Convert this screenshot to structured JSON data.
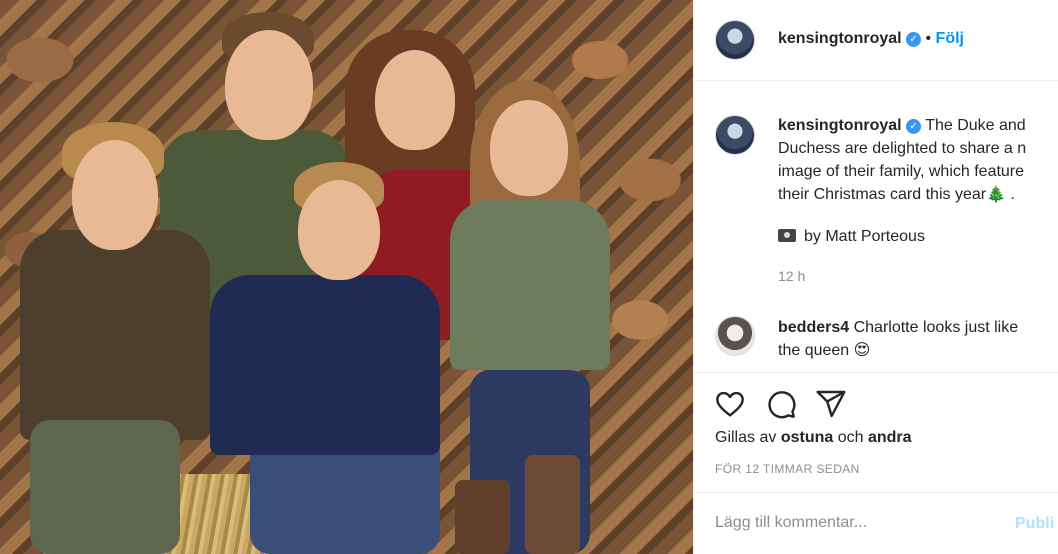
{
  "post": {
    "username": "kensingtonroyal",
    "follow_label": "Följ",
    "dot": "•"
  },
  "caption": {
    "username": "kensingtonroyal",
    "line1": "The Duke and",
    "line2": "Duchess are delighted to share a n",
    "line3": "image of their family, which feature",
    "line4": "their Christmas card this year🎄 .",
    "credit": "by Matt Porteous",
    "time": "12 h"
  },
  "comment": {
    "username": "bedders4",
    "text_line1": "Charlotte looks just like",
    "text_line2": "the queen 😍"
  },
  "actions": {
    "likes_prefix": "Gillas av",
    "likes_user": "ostuna",
    "likes_and": "och",
    "likes_others": "andra",
    "timestamp": "FÖR 12 TIMMAR SEDAN"
  },
  "comment_box": {
    "placeholder": "Lägg till kommentar...",
    "publish_label": "Publi"
  },
  "icons": [
    "heart-icon",
    "comment-icon",
    "share-icon",
    "verified-badge-icon",
    "camera-icon"
  ],
  "colors": {
    "accent": "#0095f6",
    "verified": "#3897f0",
    "muted": "#8e8e8e",
    "publish_disabled": "#b2dffc"
  }
}
